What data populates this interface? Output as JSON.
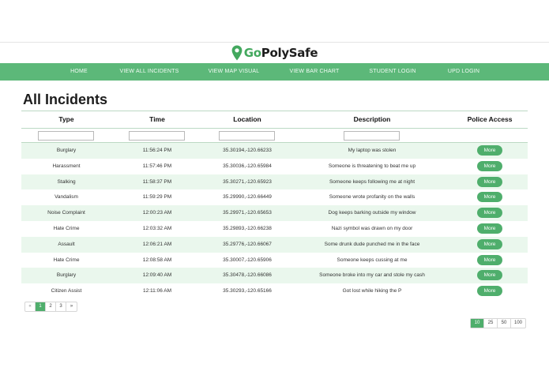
{
  "brand": {
    "go": "Go",
    "rest": "PolySafe",
    "accent": "#4fae6c",
    "nav_bg": "#5cb879",
    "pin_icon": "map-pin-icon"
  },
  "nav": [
    "HOME",
    "VIEW ALL INCIDENTS",
    "VIEW MAP VISUAL",
    "VIEW BAR CHART",
    "STUDENT LOGIN",
    "UPD LOGIN"
  ],
  "page_title": "All Incidents",
  "table": {
    "columns": [
      "Type",
      "Time",
      "Location",
      "Description",
      "Police Access"
    ],
    "button_label": "More",
    "rows": [
      {
        "type": "Burglary",
        "time": "11:56:24 PM",
        "location": "35.30194,-120.66233",
        "description": "My laptop was stolen"
      },
      {
        "type": "Harassment",
        "time": "11:57:46 PM",
        "location": "35.30036,-120.65984",
        "description": "Someone is threatening to beat me up"
      },
      {
        "type": "Stalking",
        "time": "11:58:37 PM",
        "location": "35.30271,-120.65923",
        "description": "Someone keeps following me at night"
      },
      {
        "type": "Vandalism",
        "time": "11:59:29 PM",
        "location": "35.29990,-120.66449",
        "description": "Someone wrote profanity on the walls"
      },
      {
        "type": "Noise Complaint",
        "time": "12:00:23 AM",
        "location": "35.29971,-120.65653",
        "description": "Dog keeps barking outside my window"
      },
      {
        "type": "Hate Crime",
        "time": "12:03:32 AM",
        "location": "35.29893,-120.66238",
        "description": "Nazi symbol was drawn on my door"
      },
      {
        "type": "Assault",
        "time": "12:06:21 AM",
        "location": "35.29776,-120.66067",
        "description": "Some drunk dude punched me in the face"
      },
      {
        "type": "Hate Crime",
        "time": "12:08:58 AM",
        "location": "35.30007,-120.65906",
        "description": "Someone keeps cussing at me"
      },
      {
        "type": "Burglary",
        "time": "12:09:40 AM",
        "location": "35.30478,-120.66086",
        "description": "Someone broke into my car and stole my cash"
      },
      {
        "type": "Citizen Assist",
        "time": "12:11:06 AM",
        "location": "35.30293,-120.65166",
        "description": "Got lost while hiking the P"
      }
    ]
  },
  "pagination": {
    "prev": "«",
    "pages": [
      "1",
      "2",
      "3"
    ],
    "next": "»",
    "active": "1"
  },
  "page_sizes": {
    "options": [
      "10",
      "25",
      "50",
      "100"
    ],
    "active": "10"
  }
}
